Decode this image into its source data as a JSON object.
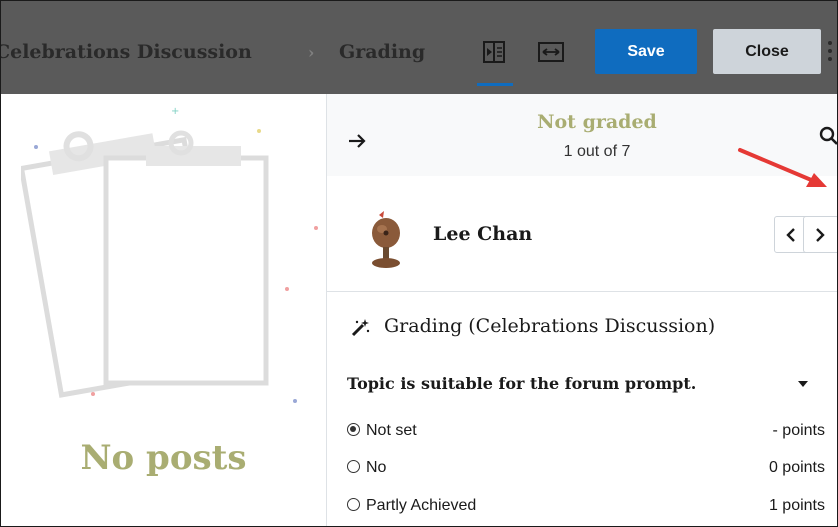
{
  "header": {
    "breadcrumb": [
      "Celebrations Discussion",
      "Grading"
    ],
    "breadcrumb_separator": "›",
    "save_label": "Save",
    "close_label": "Close",
    "icons": [
      "collapse-panel-icon",
      "expand-width-icon",
      "more-options-icon"
    ],
    "accent_color": "#0f6cbf"
  },
  "left_panel": {
    "empty_message": "No posts",
    "empty_color": "#a9ad72"
  },
  "status": {
    "title": "Not graded",
    "count": "1 out of 7"
  },
  "user": {
    "name": "Lee Chan"
  },
  "grading": {
    "title": "Grading (Celebrations Discussion)",
    "criterion": "Topic is suitable for the forum prompt.",
    "options": [
      {
        "label": "Not set",
        "points": "- points",
        "selected": true
      },
      {
        "label": "No",
        "points": "0 points",
        "selected": false
      },
      {
        "label": "Partly Achieved",
        "points": "1 points",
        "selected": false
      }
    ]
  }
}
